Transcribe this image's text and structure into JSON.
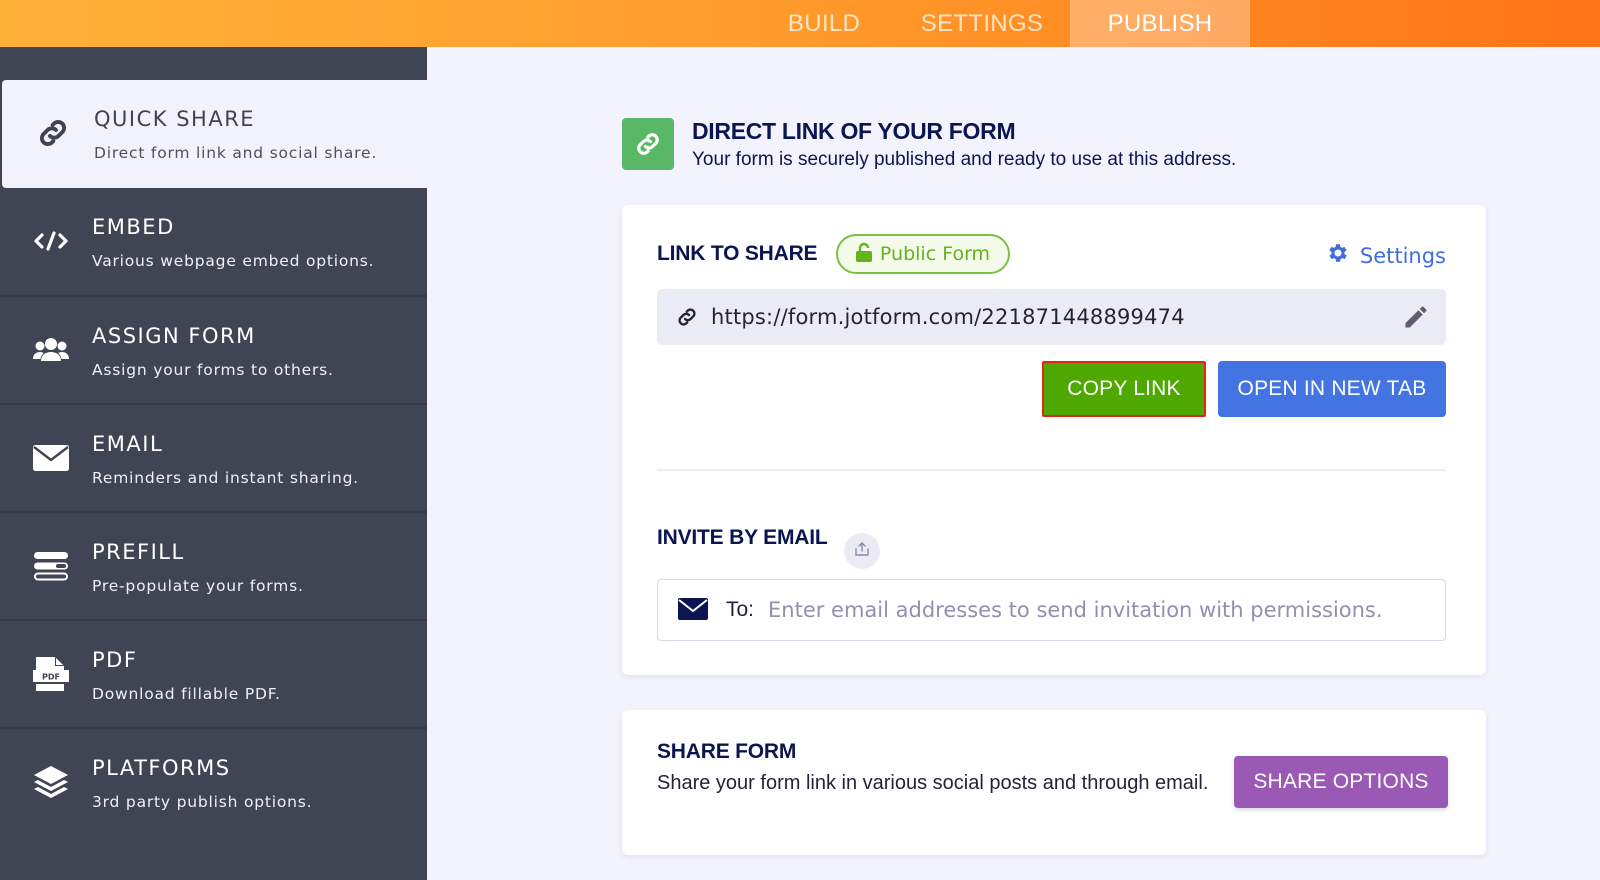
{
  "topnav": {
    "tabs": [
      {
        "label": "BUILD",
        "active": false
      },
      {
        "label": "SETTINGS",
        "active": false
      },
      {
        "label": "PUBLISH",
        "active": true
      }
    ]
  },
  "sidebar": {
    "items": [
      {
        "title": "QUICK SHARE",
        "desc": "Direct form link and social share.",
        "icon": "link-icon",
        "active": true
      },
      {
        "title": "EMBED",
        "desc": "Various webpage embed options.",
        "icon": "code-icon",
        "active": false
      },
      {
        "title": "ASSIGN FORM",
        "desc": "Assign your forms to others.",
        "icon": "users-icon",
        "active": false
      },
      {
        "title": "EMAIL",
        "desc": "Reminders and instant sharing.",
        "icon": "envelope-icon",
        "active": false
      },
      {
        "title": "PREFILL",
        "desc": "Pre-populate your forms.",
        "icon": "prefill-icon",
        "active": false
      },
      {
        "title": "PDF",
        "desc": "Download fillable PDF.",
        "icon": "pdf-icon",
        "active": false
      },
      {
        "title": "PLATFORMS",
        "desc": "3rd party publish options.",
        "icon": "layers-icon",
        "active": false
      }
    ]
  },
  "header": {
    "title": "DIRECT LINK OF YOUR FORM",
    "subtitle": "Your form is securely published and ready to use at this address."
  },
  "link_card": {
    "label": "LINK TO SHARE",
    "badge": "Public Form",
    "settings_label": "Settings",
    "url": "https://form.jotform.com/221871448899474",
    "copy_label": "COPY LINK",
    "open_label": "OPEN IN NEW TAB",
    "invite_label": "INVITE BY EMAIL",
    "to_label": "To:",
    "email_placeholder": "Enter email addresses to send invitation with permissions.",
    "email_value": ""
  },
  "share_card": {
    "title": "SHARE FORM",
    "desc": "Share your form link in various social posts and through email.",
    "button_label": "SHARE OPTIONS"
  },
  "colors": {
    "topbar_start": "#ffb23a",
    "topbar_end": "#ff7416",
    "sidebar_bg": "#3f4553",
    "page_bg": "#f3f3fe",
    "navy_text": "#0a1551",
    "public_green": "#64b21c",
    "copy_green": "#4ea800",
    "open_blue": "#4474e2",
    "share_purple": "#9b59b6",
    "highlight_red": "#e4231c"
  }
}
